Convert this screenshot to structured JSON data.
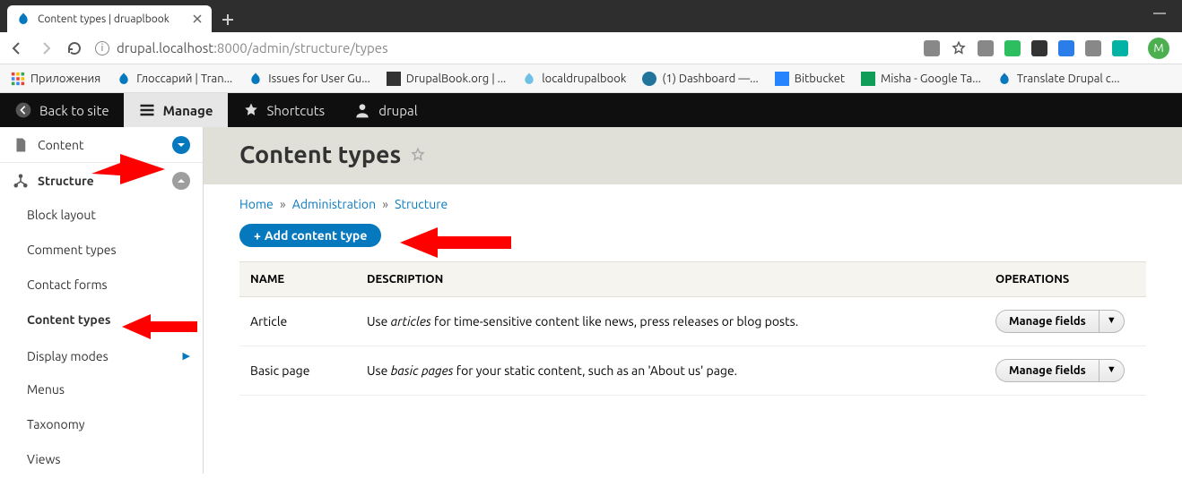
{
  "browser": {
    "tab_title": "Content types | druaplbook",
    "url_host": "drupal.localhost",
    "url_port": ":8000",
    "url_path": "/admin/structure/types",
    "avatar_letter": "M"
  },
  "bookmarks": [
    {
      "label": "Приложения"
    },
    {
      "label": "Глоссарий | Tran..."
    },
    {
      "label": "Issues for User Gu..."
    },
    {
      "label": "DrupalBook.org | ..."
    },
    {
      "label": "localdrupalbook"
    },
    {
      "label": "(1) Dashboard —..."
    },
    {
      "label": "Bitbucket"
    },
    {
      "label": "Misha - Google Ta..."
    },
    {
      "label": "Translate Drupal c..."
    }
  ],
  "toolbar": {
    "back_to_site": "Back to site",
    "manage": "Manage",
    "shortcuts": "Shortcuts",
    "user": "drupal"
  },
  "sidebar": {
    "content": "Content",
    "structure": "Structure",
    "items": [
      {
        "label": "Block layout"
      },
      {
        "label": "Comment types"
      },
      {
        "label": "Contact forms"
      },
      {
        "label": "Content types"
      },
      {
        "label": "Display modes"
      },
      {
        "label": "Menus"
      },
      {
        "label": "Taxonomy"
      },
      {
        "label": "Views"
      }
    ]
  },
  "page": {
    "title": "Content types",
    "breadcrumb": {
      "home": "Home",
      "admin": "Administration",
      "structure": "Structure"
    },
    "add_button": "Add content type",
    "table": {
      "headers": {
        "name": "NAME",
        "description": "DESCRIPTION",
        "operations": "OPERATIONS"
      },
      "rows": [
        {
          "name": "Article",
          "desc_prefix": "Use ",
          "desc_em": "articles",
          "desc_suffix": " for time-sensitive content like news, press releases or blog posts.",
          "op": "Manage fields"
        },
        {
          "name": "Basic page",
          "desc_prefix": "Use ",
          "desc_em": "basic pages",
          "desc_suffix": " for your static content, such as an 'About us' page.",
          "op": "Manage fields"
        }
      ]
    }
  }
}
